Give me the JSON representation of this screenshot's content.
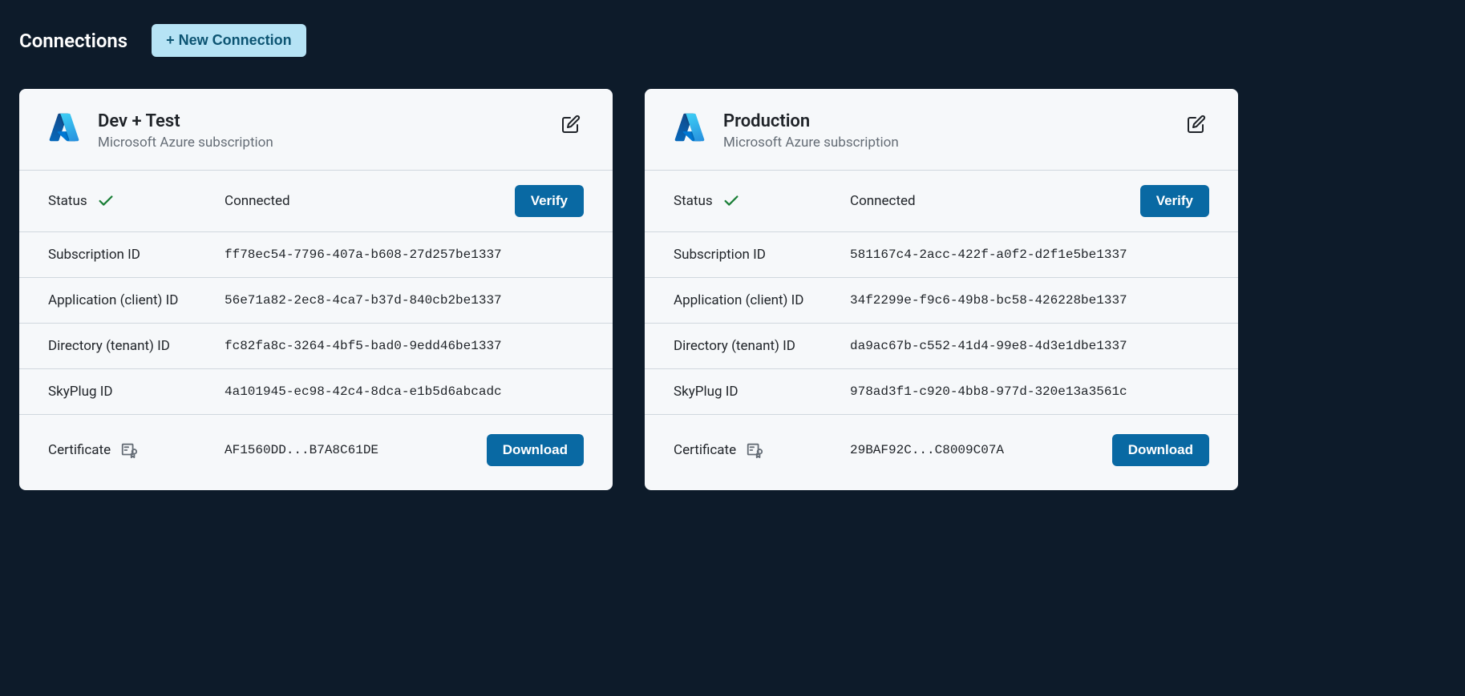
{
  "header": {
    "title": "Connections",
    "new_button": "+ New Connection"
  },
  "connections": [
    {
      "title": "Dev + Test",
      "subtitle": "Microsoft Azure subscription",
      "status_label": "Status",
      "status_value": "Connected",
      "verify_label": "Verify",
      "subscription_label": "Subscription ID",
      "subscription_value": "ff78ec54-7796-407a-b608-27d257be1337",
      "application_label": "Application (client) ID",
      "application_value": "56e71a82-2ec8-4ca7-b37d-840cb2be1337",
      "directory_label": "Directory (tenant) ID",
      "directory_value": "fc82fa8c-3264-4bf5-bad0-9edd46be1337",
      "skyplug_label": "SkyPlug ID",
      "skyplug_value": "4a101945-ec98-42c4-8dca-e1b5d6abcadc",
      "certificate_label": "Certificate",
      "certificate_value": "AF1560DD...B7A8C61DE",
      "download_label": "Download"
    },
    {
      "title": "Production",
      "subtitle": "Microsoft Azure subscription",
      "status_label": "Status",
      "status_value": "Connected",
      "verify_label": "Verify",
      "subscription_label": "Subscription ID",
      "subscription_value": "581167c4-2acc-422f-a0f2-d2f1e5be1337",
      "application_label": "Application (client) ID",
      "application_value": "34f2299e-f9c6-49b8-bc58-426228be1337",
      "directory_label": "Directory (tenant) ID",
      "directory_value": "da9ac67b-c552-41d4-99e8-4d3e1dbe1337",
      "skyplug_label": "SkyPlug ID",
      "skyplug_value": "978ad3f1-c920-4bb8-977d-320e13a3561c",
      "certificate_label": "Certificate",
      "certificate_value": "29BAF92C...C8009C07A",
      "download_label": "Download"
    }
  ]
}
